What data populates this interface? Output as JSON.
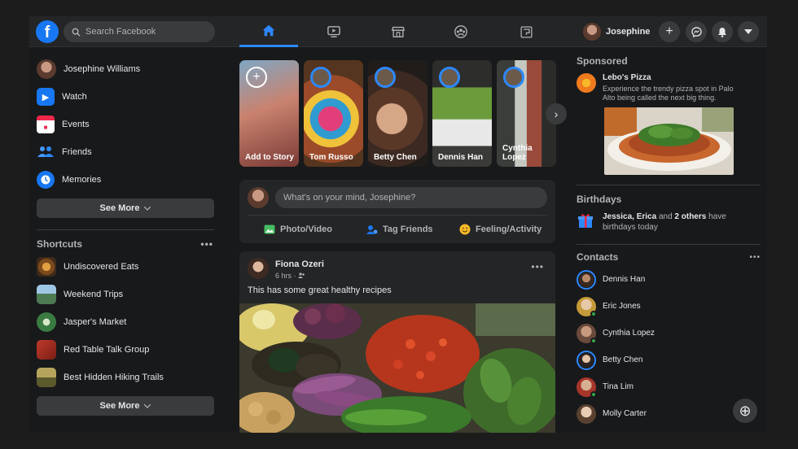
{
  "search": {
    "placeholder": "Search Facebook"
  },
  "nav": {
    "tabs": [
      "home",
      "watch",
      "marketplace",
      "groups",
      "gaming"
    ]
  },
  "profile": {
    "name": "Josephine"
  },
  "left": {
    "items": [
      {
        "label": "Josephine Williams",
        "icon": "user-avatar"
      },
      {
        "label": "Watch",
        "icon": "watch-icon"
      },
      {
        "label": "Events",
        "icon": "calendar-icon"
      },
      {
        "label": "Friends",
        "icon": "friends-icon"
      },
      {
        "label": "Memories",
        "icon": "clock-icon"
      }
    ],
    "see_more": "See More",
    "shortcuts_title": "Shortcuts",
    "shortcuts": [
      {
        "label": "Undiscovered Eats"
      },
      {
        "label": "Weekend Trips"
      },
      {
        "label": "Jasper's Market"
      },
      {
        "label": "Red Table Talk Group"
      },
      {
        "label": "Best Hidden Hiking Trails"
      }
    ],
    "see_more_2": "See More"
  },
  "stories": [
    {
      "name": "Add to Story"
    },
    {
      "name": "Tom Russo"
    },
    {
      "name": "Betty Chen"
    },
    {
      "name": "Dennis Han"
    },
    {
      "name": "Cynthia Lopez"
    }
  ],
  "composer": {
    "placeholder": "What's on your mind, Josephine?",
    "photo": "Photo/Video",
    "tag": "Tag Friends",
    "feeling": "Feeling/Activity"
  },
  "post": {
    "author": "Fiona Ozeri",
    "time": "6 hrs",
    "text": "This has some great healthy recipes"
  },
  "right": {
    "sponsored_title": "Sponsored",
    "ad_title": "Lebo's Pizza",
    "ad_desc": "Experience the trendy pizza spot in Palo Alto being called the next big thing.",
    "birthdays_title": "Birthdays",
    "bday_names": "Jessica, Erica",
    "bday_and": " and ",
    "bday_others": "2 others",
    "bday_tail": " have birthdays today",
    "contacts_title": "Contacts",
    "contacts": [
      {
        "name": "Dennis Han"
      },
      {
        "name": "Eric Jones"
      },
      {
        "name": "Cynthia Lopez"
      },
      {
        "name": "Betty Chen"
      },
      {
        "name": "Tina Lim"
      },
      {
        "name": "Molly Carter"
      }
    ]
  },
  "colors": {
    "accent": "#2d88ff",
    "bg": "#18191a",
    "card": "#242526",
    "online": "#31a24c"
  }
}
